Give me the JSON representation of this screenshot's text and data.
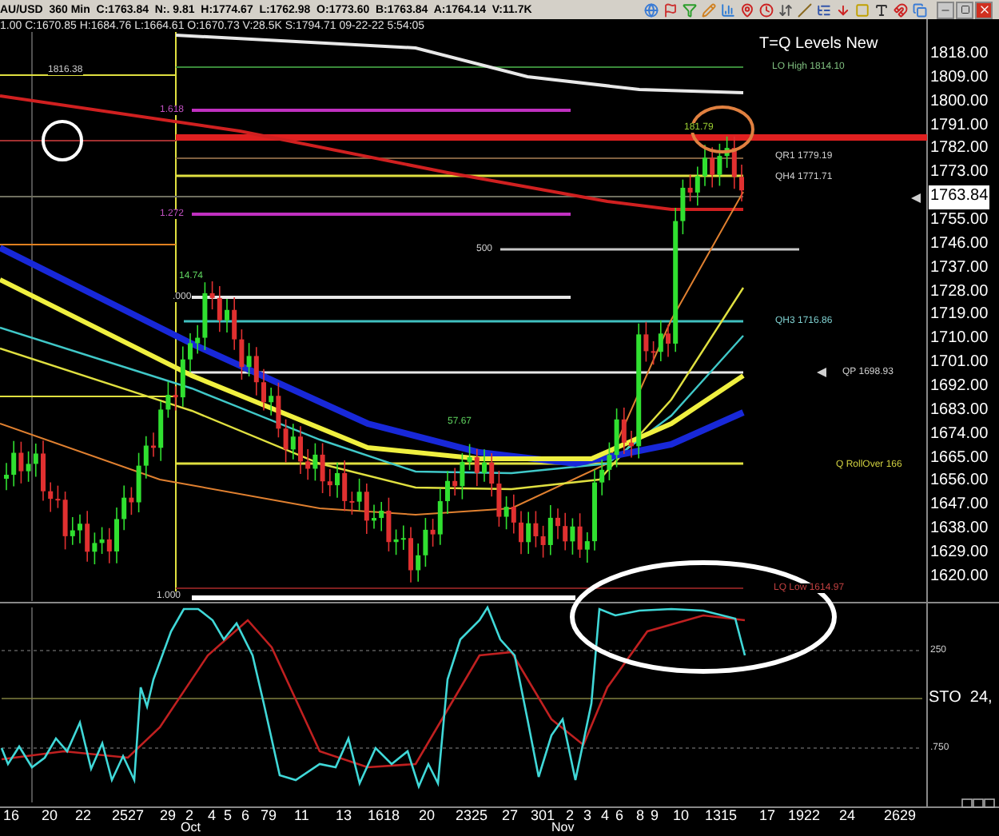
{
  "toolbar": {
    "quote": "AU/USD  360 Min  C:1763.84  N:. 9.81  H:1774.67  L:1762.98  O:1773.60  B:1763.84  A:1764.14  V:11.7K"
  },
  "info_line": "1.00 C:1670.85 H:1684.76 L:1664.61 O:1670.73 V:28.5K S:1794.71 09-22-22 5:54:05",
  "chart": {
    "title": "T=Q Levels New",
    "labels": [
      "1816.38",
      "LO High 1814.10",
      "1.618",
      "181.79",
      "QR1 1779.19",
      "QH4 1771.71",
      "1.272",
      "500",
      "14.74",
      ".000",
      "QH3 1716.86",
      "QP 1698.93",
      "57.67",
      "Q RollOver 166",
      "1.000",
      "LQ Low 1614.97"
    ],
    "last_price": "1763.84",
    "price_axis": [
      "1818.00",
      "1809.00",
      "1800.00",
      "1791.00",
      "1782.00",
      "1773.00",
      "1755.00",
      "1746.00",
      "1737.00",
      "1728.00",
      "1719.00",
      "1710.00",
      "1701.00",
      "1692.00",
      "1683.00",
      "1674.00",
      "1665.00",
      "1656.00",
      "1647.00",
      "1638.00",
      "1629.00",
      "1620.00"
    ]
  },
  "oscillator": {
    "name": "STO  24,",
    "axis": [
      "250",
      ".750"
    ]
  },
  "date_axis": {
    "days": [
      "16",
      "20",
      "22",
      "2527",
      "29",
      "2",
      "4",
      "5",
      "6",
      "79",
      "11",
      "13",
      "1618",
      "20",
      "2325",
      "27",
      "301",
      "2",
      "3",
      "4",
      "6",
      "8",
      "9",
      "10",
      "1315",
      "17",
      "1922",
      "24",
      "2629"
    ],
    "months": [
      "Oct",
      "Nov"
    ]
  }
}
